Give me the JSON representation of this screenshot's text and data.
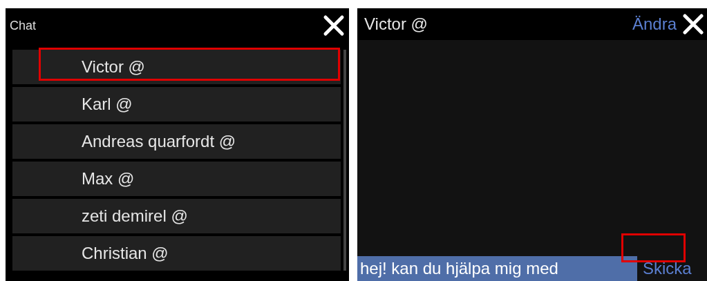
{
  "contacts_screen": {
    "title": "Chat",
    "contacts": [
      {
        "name": "Victor @",
        "marked": true
      },
      {
        "name": "Karl @",
        "marked": false
      },
      {
        "name": "Andreas quarfordt @",
        "marked": false
      },
      {
        "name": "Max @",
        "marked": false
      },
      {
        "name": "zeti demirel @",
        "marked": false
      },
      {
        "name": "Christian  @",
        "marked": false
      }
    ]
  },
  "chat_screen": {
    "title": "Victor @",
    "edit_link": "Ändra",
    "message_value": "hej! kan du hjälpa mig med",
    "send_button": "Skicka",
    "send_area_marked": true
  }
}
